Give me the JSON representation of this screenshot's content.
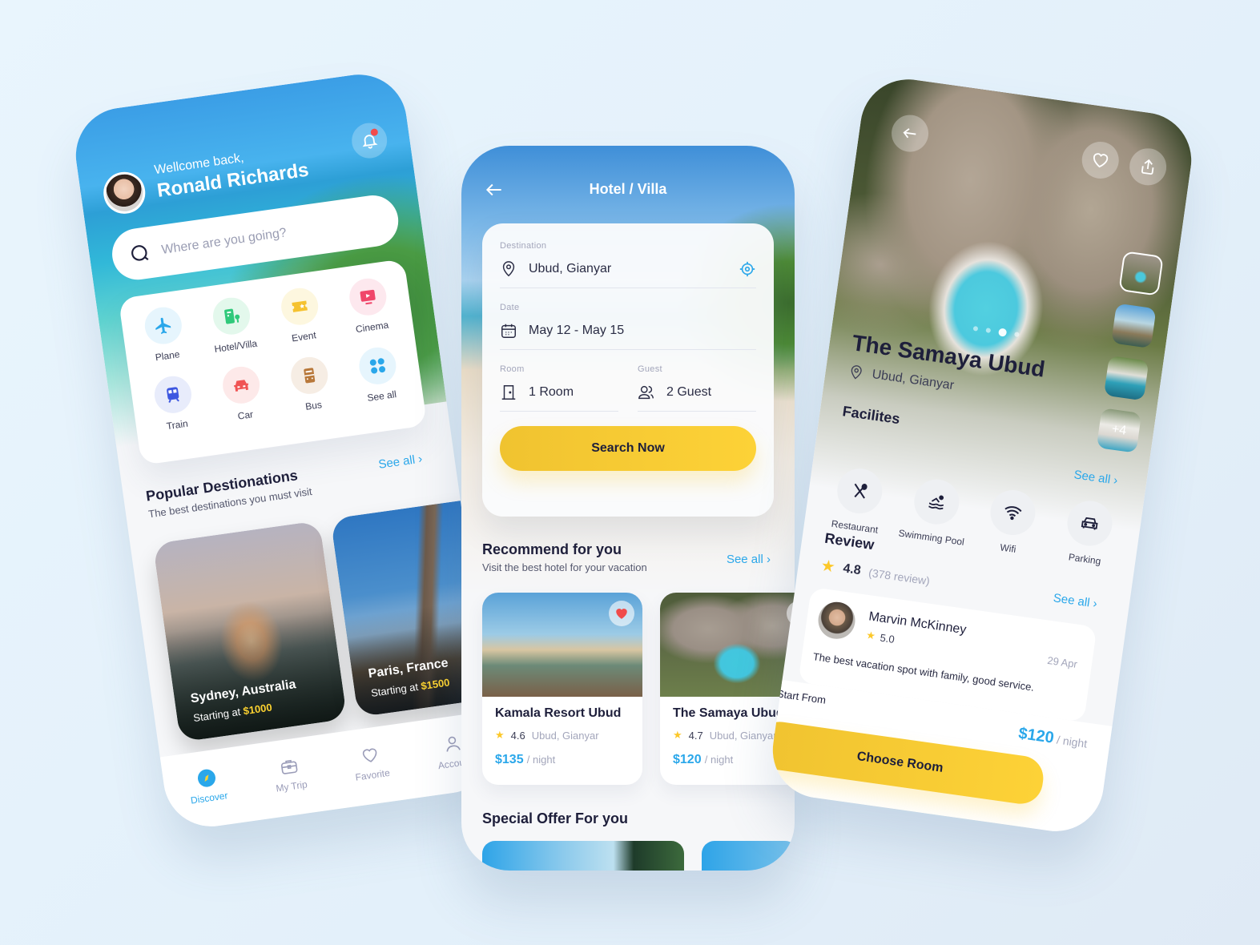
{
  "screens": {
    "home": {
      "greeting": "Wellcome back,",
      "user_name": "Ronald Richards",
      "search_placeholder": "Where are you going?",
      "categories": [
        {
          "label": "Plane",
          "icon": "plane-icon",
          "color": "#2aa7ea",
          "bg": "#e6f5fd"
        },
        {
          "label": "Hotel/Villa",
          "icon": "hotel-icon",
          "color": "#2fc97a",
          "bg": "#e3f8ec"
        },
        {
          "label": "Event",
          "icon": "ticket-icon",
          "color": "#f5c230",
          "bg": "#fdf7df"
        },
        {
          "label": "Cinema",
          "icon": "cinema-icon",
          "color": "#f0466a",
          "bg": "#fde8ee"
        },
        {
          "label": "Train",
          "icon": "train-icon",
          "color": "#3d57e0",
          "bg": "#e8ecfb"
        },
        {
          "label": "Car",
          "icon": "car-icon",
          "color": "#f05454",
          "bg": "#fde9e9"
        },
        {
          "label": "Bus",
          "icon": "bus-icon",
          "color": "#b8783a",
          "bg": "#f6ede4"
        },
        {
          "label": "See all",
          "icon": "grid-icon",
          "color": "#2aa7ea",
          "bg": "#e6f5fd"
        }
      ],
      "popular": {
        "title": "Popular Destionations",
        "subtitle": "The best destinations you must visit",
        "see_all": "See all",
        "destinations": [
          {
            "name": "Sydney, Australia",
            "price_prefix": "Starting at",
            "price": "$1000"
          },
          {
            "name": "Paris, France",
            "price_prefix": "Starting at",
            "price": "$1500"
          }
        ]
      },
      "tabs": [
        {
          "label": "Discover",
          "icon": "compass-icon",
          "active": true
        },
        {
          "label": "My Trip",
          "icon": "briefcase-icon",
          "active": false
        },
        {
          "label": "Favorite",
          "icon": "heart-icon",
          "active": false
        },
        {
          "label": "Account",
          "icon": "user-icon",
          "active": false
        }
      ]
    },
    "search": {
      "title": "Hotel / Villa",
      "destination_label": "Destination",
      "destination_value": "Ubud, Gianyar",
      "date_label": "Date",
      "date_value": "May 12 - May 15",
      "room_label": "Room",
      "room_value": "1 Room",
      "guest_label": "Guest",
      "guest_value": "2 Guest",
      "search_button": "Search Now",
      "recommend": {
        "title": "Recommend for you",
        "subtitle": "Visit the best hotel for your vacation",
        "see_all": "See all",
        "hotels": [
          {
            "name": "Kamala Resort Ubud",
            "rating": "4.6",
            "location": "Ubud, Gianyar",
            "price": "$135",
            "unit": "/ night",
            "favorited": true
          },
          {
            "name": "The Samaya Ubud",
            "rating": "4.7",
            "location": "Ubud, Gianyar",
            "price": "$120",
            "unit": "/ night",
            "favorited": false
          }
        ]
      },
      "special_offer_title": "Special Offer For you"
    },
    "detail": {
      "name": "The Samaya Ubud",
      "location": "Ubud, Gianyar",
      "extra_photos": "+4",
      "gallery_index": 3,
      "gallery_count": 4,
      "facilities_title": "Facilites",
      "facilities_see_all": "See all",
      "facilities": [
        {
          "label": "Restaurant",
          "icon": "restaurant-icon"
        },
        {
          "label": "Swimming Pool",
          "icon": "swimming-icon"
        },
        {
          "label": "Wifi",
          "icon": "wifi-icon"
        },
        {
          "label": "Parking",
          "icon": "car-icon"
        }
      ],
      "review_title": "Review",
      "review_score": "4.8",
      "review_count": "(378 review)",
      "review_see_all": "See all",
      "review": {
        "name": "Marvin McKinney",
        "rating": "5.0",
        "date": "29 Apr",
        "text": "The best vacation spot with family, good service."
      },
      "start_from_label": "Start From",
      "price": "$120",
      "price_unit": "/ night",
      "choose_button": "Choose Room"
    }
  },
  "colors": {
    "accent_blue": "#2aa7ea",
    "accent_yellow": "#fdd237",
    "text_dark": "#1e1f3b",
    "notification_red": "#f24b4b"
  }
}
